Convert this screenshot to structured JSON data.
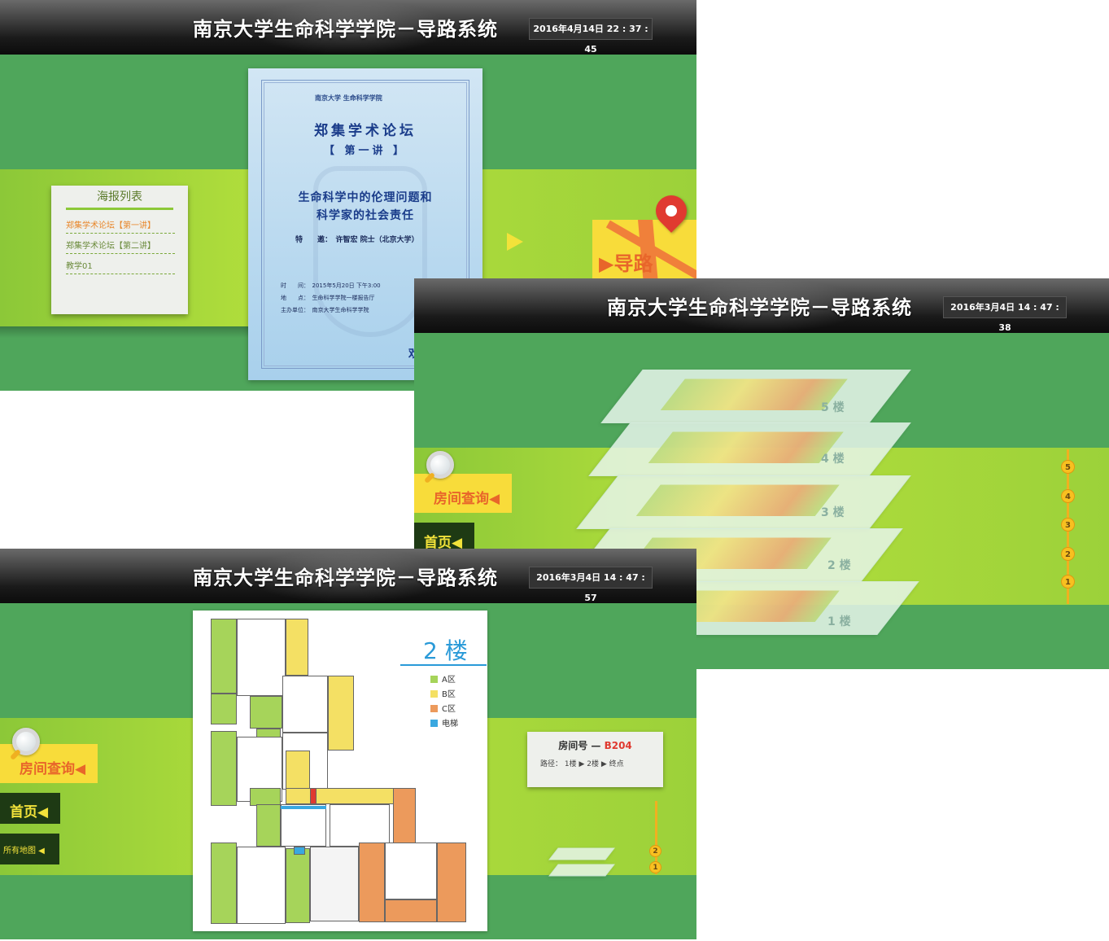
{
  "app_title": "南京大学生命科学学院－导路系统",
  "screen1": {
    "datetime": "2016年4月14日 22 : 37 : 45",
    "poster_list": {
      "heading": "海报列表",
      "items": [
        "郑集学术论坛【第一讲】",
        "郑集学术论坛【第二讲】",
        "教学01"
      ]
    },
    "poster": {
      "institution": "南京大学 生命科学学院",
      "title": "郑集学术论坛",
      "lecture": "【 第一讲 】",
      "topic_line1": "生命科学中的伦理问题和",
      "topic_line2": "科学家的社会责任",
      "guest": "特　　邀：　许智宏  院士（北京大学）",
      "time": "时　　间：　2015年5月20日 下午3:00",
      "place": "地　　点：　生命科学学院一楼报告厅",
      "host": "主办单位：　南京大学生命科学学院",
      "corner": "欢"
    },
    "nav_label": "▶导路"
  },
  "screen2": {
    "datetime": "2016年3月4日 14 : 47 : 38",
    "search_label": "房间查询◀",
    "home_label": "首页◀",
    "floors": [
      "5 楼",
      "4 楼",
      "3 楼",
      "2 楼",
      "1 楼"
    ],
    "floor_buttons": [
      "5",
      "4",
      "3",
      "2",
      "1"
    ]
  },
  "screen3": {
    "datetime": "2016年3月4日 14 : 47 : 57",
    "search_label": "房间查询◀",
    "home_label": "首页◀",
    "all_maps_label": "所有地图 ◀",
    "map_floor": "2 楼",
    "legend": [
      {
        "label": "A区",
        "color": "#a6d45a"
      },
      {
        "label": "B区",
        "color": "#f4e064"
      },
      {
        "label": "C区",
        "color": "#ec9a5c"
      },
      {
        "label": "电梯",
        "color": "#3aa8e0"
      }
    ],
    "room_card": {
      "label": "房间号 — ",
      "number": "B204",
      "route": "路径： 1楼 ▶ 2楼 ▶ 终点"
    },
    "floor_buttons": [
      "2",
      "1"
    ]
  },
  "colors": {
    "screen_bg": "#4fa65b",
    "band": "#b4e03c",
    "accent_yellow": "#f8dc3a",
    "accent_orange": "#e8662a",
    "zone_a": "#a6d45a",
    "zone_b": "#f4e064",
    "zone_c": "#ec9a5c",
    "elevator": "#3aa8e0"
  }
}
